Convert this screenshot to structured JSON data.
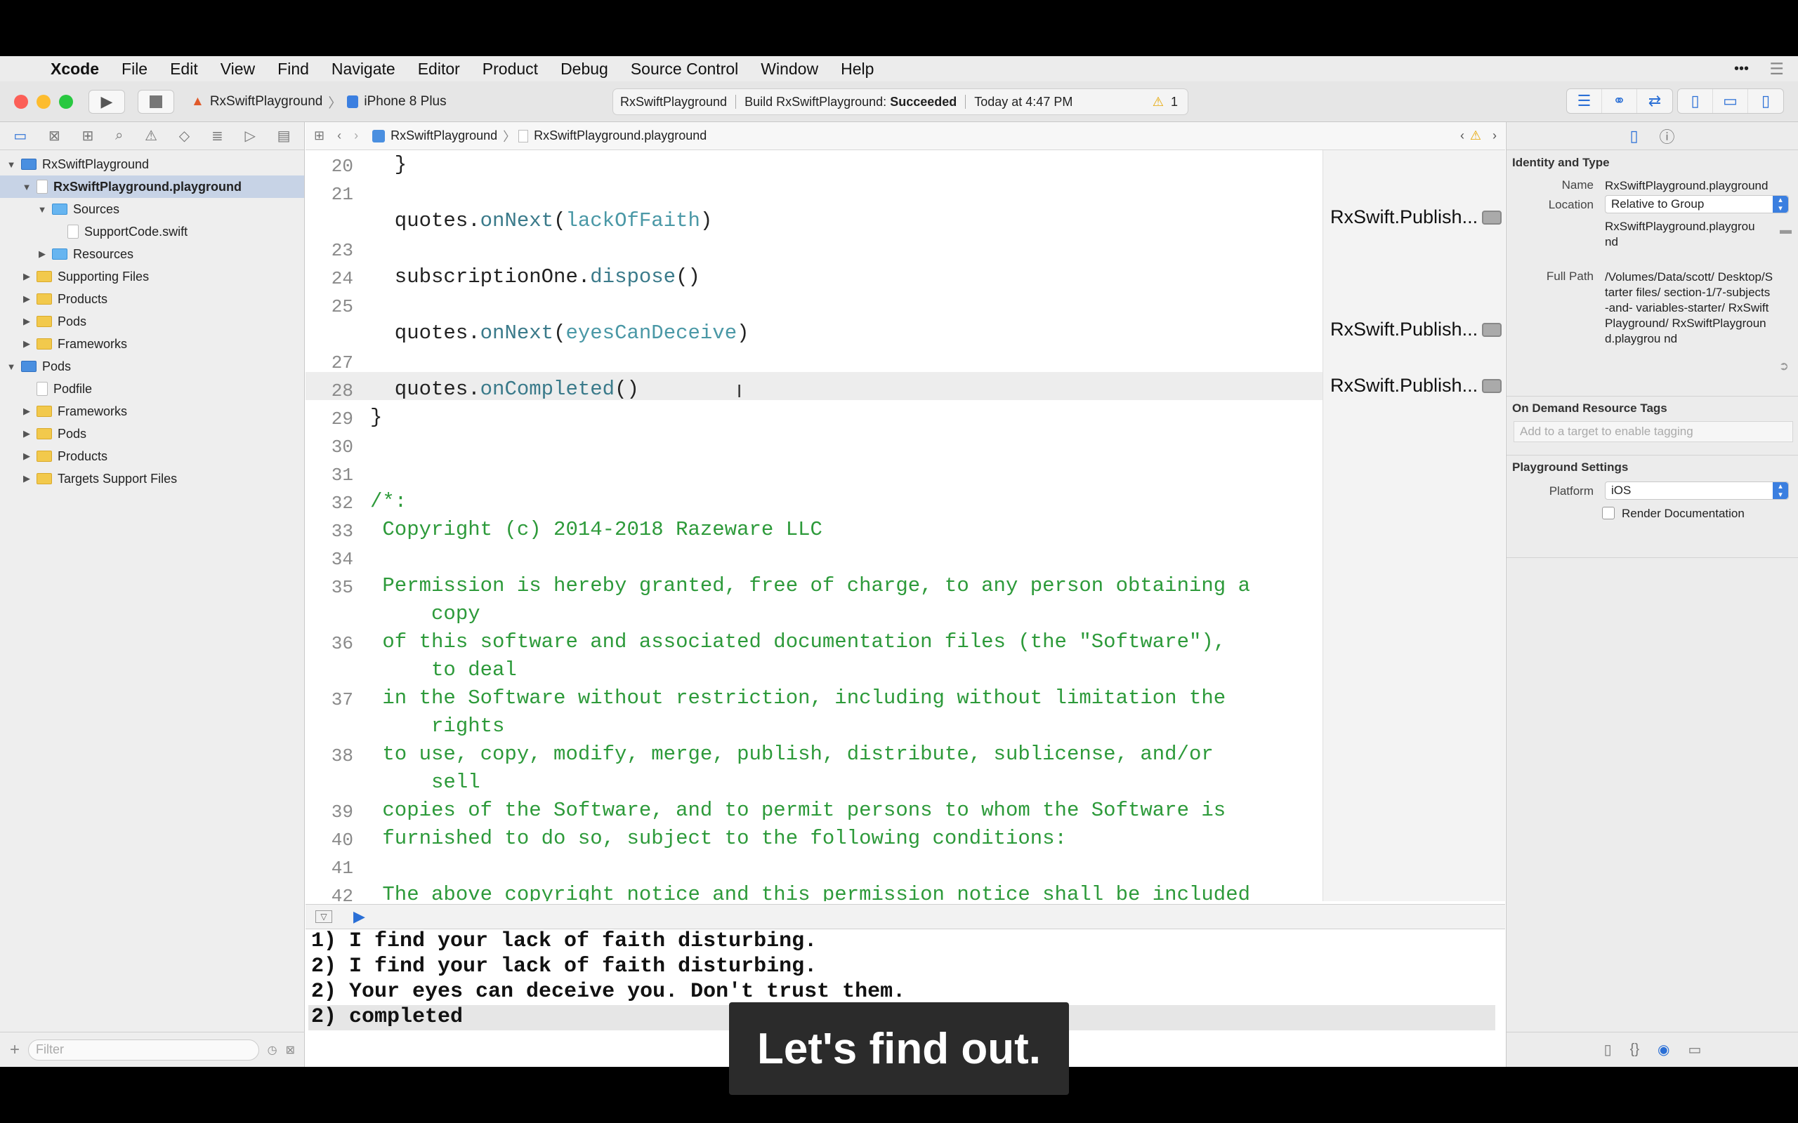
{
  "menubar": {
    "apple": "",
    "app": "Xcode",
    "items": [
      "File",
      "Edit",
      "View",
      "Find",
      "Navigate",
      "Editor",
      "Product",
      "Debug",
      "Source Control",
      "Window",
      "Help"
    ],
    "more": "•••",
    "list": "☰"
  },
  "toolbar": {
    "scheme": "RxSwiftPlayground",
    "device": "iPhone 8 Plus",
    "activity_project": "RxSwiftPlayground",
    "activity_build_prefix": "Build RxSwiftPlayground:",
    "activity_build_status": "Succeeded",
    "activity_time": "Today at 4:47 PM",
    "warning_count": "1"
  },
  "navigator": {
    "items": [
      {
        "label": "RxSwiftPlayground",
        "indent": 0,
        "tri": "▼",
        "icon": "proj"
      },
      {
        "label": "RxSwiftPlayground.playground",
        "indent": 1,
        "tri": "▼",
        "icon": "swift",
        "selected": true
      },
      {
        "label": "Sources",
        "indent": 2,
        "tri": "▼",
        "icon": "fold-b"
      },
      {
        "label": "SupportCode.swift",
        "indent": 3,
        "tri": "",
        "icon": "swift"
      },
      {
        "label": "Resources",
        "indent": 2,
        "tri": "▶",
        "icon": "fold-b"
      },
      {
        "label": "Supporting Files",
        "indent": 1,
        "tri": "▶",
        "icon": "fold-y"
      },
      {
        "label": "Products",
        "indent": 1,
        "tri": "▶",
        "icon": "fold-y"
      },
      {
        "label": "Pods",
        "indent": 1,
        "tri": "▶",
        "icon": "fold-y"
      },
      {
        "label": "Frameworks",
        "indent": 1,
        "tri": "▶",
        "icon": "fold-y"
      },
      {
        "label": "Pods",
        "indent": 0,
        "tri": "▼",
        "icon": "proj"
      },
      {
        "label": "Podfile",
        "indent": 1,
        "tri": "",
        "icon": "pod"
      },
      {
        "label": "Frameworks",
        "indent": 1,
        "tri": "▶",
        "icon": "fold-y"
      },
      {
        "label": "Pods",
        "indent": 1,
        "tri": "▶",
        "icon": "fold-y"
      },
      {
        "label": "Products",
        "indent": 1,
        "tri": "▶",
        "icon": "fold-y"
      },
      {
        "label": "Targets Support Files",
        "indent": 1,
        "tri": "▶",
        "icon": "fold-y"
      }
    ],
    "filter_placeholder": "Filter"
  },
  "jumpbar": {
    "crumb1": "RxSwiftPlayground",
    "crumb2": "RxSwiftPlayground.playground"
  },
  "editor": {
    "lines": [
      {
        "n": "20",
        "t": "  }",
        "k": "id"
      },
      {
        "n": "21",
        "t": "",
        "k": "id"
      },
      {
        "n": "",
        "t": "  quotes.onNext(lackOfFaith)",
        "k": "call1"
      },
      {
        "n": "23",
        "t": "",
        "k": "id"
      },
      {
        "n": "24",
        "t": "  subscriptionOne.dispose()",
        "k": "call2"
      },
      {
        "n": "25",
        "t": "",
        "k": "id"
      },
      {
        "n": "",
        "t": "  quotes.onNext(eyesCanDeceive)",
        "k": "call3"
      },
      {
        "n": "27",
        "t": "",
        "k": "id"
      },
      {
        "n": "28",
        "t": "  quotes.onCompleted()",
        "k": "call4"
      },
      {
        "n": "29",
        "t": "}",
        "k": "id"
      },
      {
        "n": "30",
        "t": "",
        "k": "id"
      },
      {
        "n": "31",
        "t": "",
        "k": "id"
      },
      {
        "n": "32",
        "t": "/*:",
        "k": "cmt"
      },
      {
        "n": "33",
        "t": " Copyright (c) 2014-2018 Razeware LLC",
        "k": "cmt"
      },
      {
        "n": "34",
        "t": "",
        "k": "cmt"
      },
      {
        "n": "35",
        "t": " Permission is hereby granted, free of charge, to any person obtaining a",
        "k": "cmt"
      },
      {
        "n": "",
        "t": "     copy",
        "k": "cmt"
      },
      {
        "n": "36",
        "t": " of this software and associated documentation files (the \"Software\"),",
        "k": "cmt"
      },
      {
        "n": "",
        "t": "     to deal",
        "k": "cmt"
      },
      {
        "n": "37",
        "t": " in the Software without restriction, including without limitation the",
        "k": "cmt"
      },
      {
        "n": "",
        "t": "     rights",
        "k": "cmt"
      },
      {
        "n": "38",
        "t": " to use, copy, modify, merge, publish, distribute, sublicense, and/or",
        "k": "cmt"
      },
      {
        "n": "",
        "t": "     sell",
        "k": "cmt"
      },
      {
        "n": "39",
        "t": " copies of the Software, and to permit persons to whom the Software is",
        "k": "cmt"
      },
      {
        "n": "40",
        "t": " furnished to do so, subject to the following conditions:",
        "k": "cmt"
      },
      {
        "n": "41",
        "t": "",
        "k": "cmt"
      },
      {
        "n": "42",
        "t": " The above copyright notice and this permission notice shall be included",
        "k": "cmt"
      }
    ],
    "results": [
      "RxSwift.Publish...",
      "RxSwift.Publish...",
      "RxSwift.Publish..."
    ]
  },
  "console": {
    "lines": [
      "1) I find your lack of faith disturbing.",
      "2) I find your lack of faith disturbing.",
      "2) Your eyes can deceive you. Don't trust them.",
      "2) completed"
    ]
  },
  "inspector": {
    "identity_title": "Identity and Type",
    "name_label": "Name",
    "name_value": "RxSwiftPlayground.playground",
    "location_label": "Location",
    "location_value": "Relative to Group",
    "location_file": "RxSwiftPlayground.playgrou nd",
    "fullpath_label": "Full Path",
    "fullpath_value": "/Volumes/Data/scott/ Desktop/Starter files/ section-1/7-subjects-and- variables-starter/ RxSwiftPlayground/ RxSwiftPlayground.playgrou nd",
    "odr_title": "On Demand Resource Tags",
    "odr_placeholder": "Add to a target to enable tagging",
    "pg_title": "Playground Settings",
    "platform_label": "Platform",
    "platform_value": "iOS",
    "render_doc": "Render Documentation"
  },
  "caption": "Let's find out."
}
